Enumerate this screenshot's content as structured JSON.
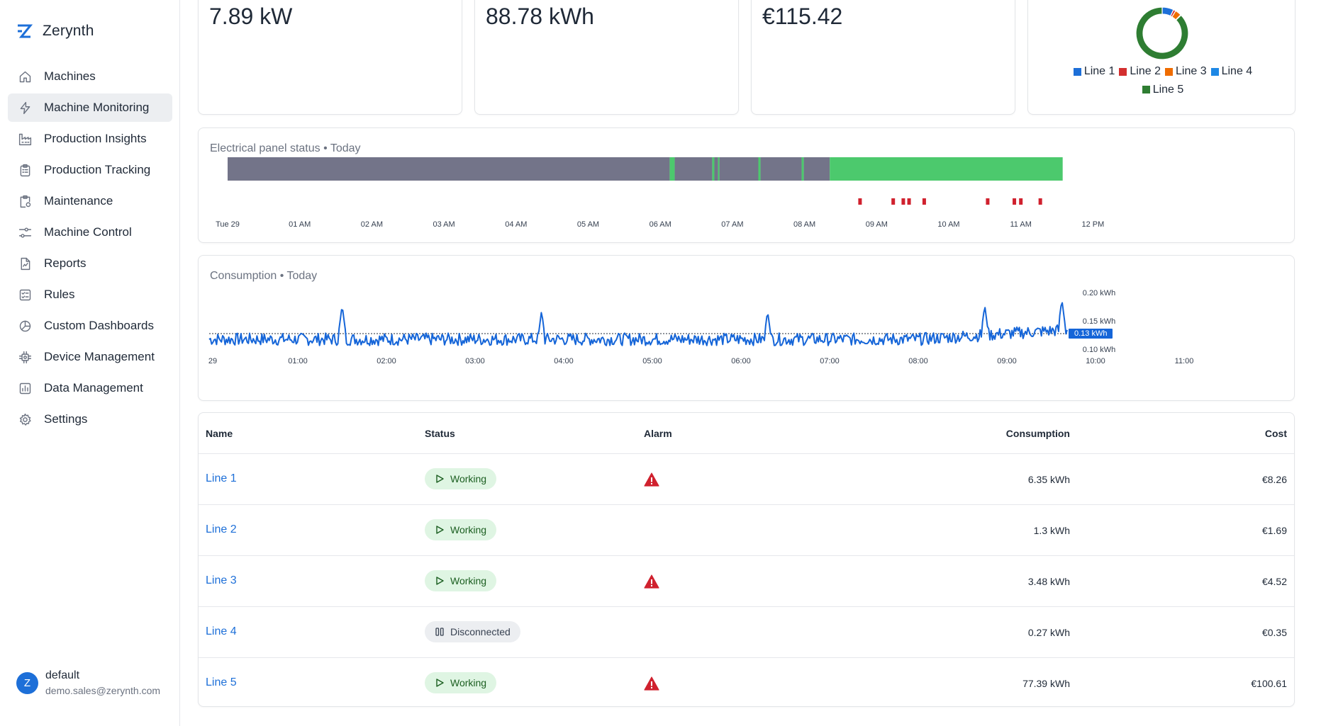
{
  "brand": {
    "name": "Zerynth",
    "accent": "#1d6fd8"
  },
  "sidebar": {
    "items": [
      {
        "label": "Machines",
        "icon": "home-icon",
        "active": false
      },
      {
        "label": "Machine Monitoring",
        "icon": "bolt-icon",
        "active": true
      },
      {
        "label": "Production Insights",
        "icon": "factory-icon",
        "active": false
      },
      {
        "label": "Production Tracking",
        "icon": "clipboard-icon",
        "active": false
      },
      {
        "label": "Maintenance",
        "icon": "clipboard-gear-icon",
        "active": false
      },
      {
        "label": "Machine Control",
        "icon": "sliders-icon",
        "active": false
      },
      {
        "label": "Reports",
        "icon": "report-icon",
        "active": false
      },
      {
        "label": "Rules",
        "icon": "checklist-icon",
        "active": false
      },
      {
        "label": "Custom Dashboards",
        "icon": "dashboard-icon",
        "active": false
      },
      {
        "label": "Device Management",
        "icon": "chip-icon",
        "active": false
      },
      {
        "label": "Data Management",
        "icon": "bar-chart-icon",
        "active": false
      },
      {
        "label": "Settings",
        "icon": "gear-icon",
        "active": false
      }
    ]
  },
  "user": {
    "initial": "Z",
    "name": "default",
    "email": "demo.sales@zerynth.com"
  },
  "kpis": {
    "power": "7.89 kW",
    "energy": "88.78 kWh",
    "cost": "€115.42"
  },
  "pie": {
    "legend": [
      {
        "label": "Line 1",
        "color": "#1d6fd8"
      },
      {
        "label": "Line 2",
        "color": "#d32f2f"
      },
      {
        "label": "Line 3",
        "color": "#ef6c00"
      },
      {
        "label": "Line 4",
        "color": "#1e88e5"
      },
      {
        "label": "Line 5",
        "color": "#2e7d32"
      }
    ],
    "values": [
      6.35,
      1.3,
      3.48,
      0.27,
      77.39
    ]
  },
  "panel_status": {
    "title": "Electrical panel status • Today",
    "ticks": [
      "Tue 29",
      "01 AM",
      "02 AM",
      "03 AM",
      "04 AM",
      "05 AM",
      "06 AM",
      "07 AM",
      "08 AM",
      "09 AM",
      "10 AM",
      "11 AM",
      "12 PM"
    ],
    "colors": {
      "off": "#737489",
      "on": "#4cc96d",
      "alarm": "#d0212e"
    },
    "segments_hours": [
      {
        "start": 0,
        "end": 6.13,
        "state": "off"
      },
      {
        "start": 6.13,
        "end": 6.2,
        "state": "on"
      },
      {
        "start": 6.2,
        "end": 6.72,
        "state": "off"
      },
      {
        "start": 6.72,
        "end": 6.75,
        "state": "on"
      },
      {
        "start": 6.75,
        "end": 6.8,
        "state": "off"
      },
      {
        "start": 6.8,
        "end": 6.82,
        "state": "on"
      },
      {
        "start": 6.82,
        "end": 7.36,
        "state": "off"
      },
      {
        "start": 7.36,
        "end": 7.39,
        "state": "on"
      },
      {
        "start": 7.39,
        "end": 7.96,
        "state": "off"
      },
      {
        "start": 7.96,
        "end": 7.99,
        "state": "on"
      },
      {
        "start": 7.99,
        "end": 8.35,
        "state": "off"
      },
      {
        "start": 8.35,
        "end": 11.58,
        "state": "on"
      }
    ],
    "alarm_hours": [
      8.77,
      9.23,
      9.37,
      9.45,
      9.66,
      10.54,
      10.91,
      11.0,
      11.27
    ]
  },
  "consumption": {
    "title": "Consumption • Today",
    "x_ticks": [
      "29",
      "01:00",
      "02:00",
      "03:00",
      "04:00",
      "05:00",
      "06:00",
      "07:00",
      "08:00",
      "09:00",
      "10:00",
      "11:00"
    ],
    "y_ticks": [
      "0.20 kWh",
      "0.15 kWh",
      "0.10 kWh"
    ],
    "current_value": "0.13 kWh",
    "line_color": "#1565d8"
  },
  "chart_data": {
    "type": "line",
    "title": "Consumption • Today",
    "xlabel": "",
    "ylabel": "",
    "x": [
      "00:00",
      "01:00",
      "02:00",
      "03:00",
      "04:00",
      "05:00",
      "06:00",
      "07:00",
      "08:00",
      "09:00",
      "10:00",
      "11:00",
      "11:30"
    ],
    "series": [
      {
        "values": [
          0.12,
          0.12,
          0.12,
          0.12,
          0.12,
          0.12,
          0.12,
          0.12,
          0.12,
          0.13,
          0.14,
          0.14,
          0.13
        ]
      }
    ],
    "ylim": [
      0.08,
      0.22
    ],
    "peaks": [
      [
        1.5,
        0.18
      ],
      [
        3.75,
        0.17
      ],
      [
        6.3,
        0.17
      ],
      [
        8.75,
        0.18
      ],
      [
        9.62,
        0.19
      ],
      [
        10.55,
        0.21
      ]
    ],
    "reference_value": 0.13,
    "grid": false
  },
  "table": {
    "headers": {
      "name": "Name",
      "status": "Status",
      "alarm": "Alarm",
      "consumption": "Consumption",
      "cost": "Cost"
    },
    "rows": [
      {
        "name": "Line 1",
        "status": "Working",
        "state": "ok",
        "alarm": true,
        "consumption": "6.35 kWh",
        "cost": "€8.26"
      },
      {
        "name": "Line 2",
        "status": "Working",
        "state": "ok",
        "alarm": false,
        "consumption": "1.3 kWh",
        "cost": "€1.69"
      },
      {
        "name": "Line 3",
        "status": "Working",
        "state": "ok",
        "alarm": true,
        "consumption": "3.48 kWh",
        "cost": "€4.52"
      },
      {
        "name": "Line 4",
        "status": "Disconnected",
        "state": "off",
        "alarm": false,
        "consumption": "0.27 kWh",
        "cost": "€0.35"
      },
      {
        "name": "Line 5",
        "status": "Working",
        "state": "ok",
        "alarm": true,
        "consumption": "77.39 kWh",
        "cost": "€100.61"
      }
    ]
  }
}
